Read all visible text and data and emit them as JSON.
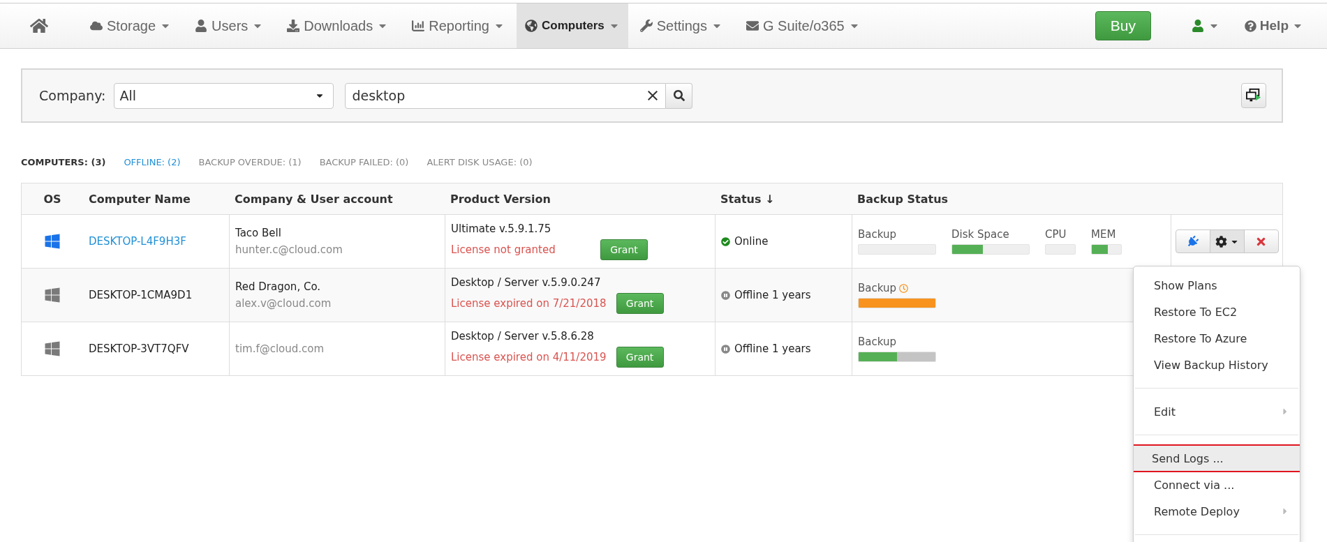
{
  "nav": {
    "items": [
      {
        "label": "Storage",
        "selected": false
      },
      {
        "label": "Users",
        "selected": false
      },
      {
        "label": "Downloads",
        "selected": false
      },
      {
        "label": "Reporting",
        "selected": false
      },
      {
        "label": "Computers",
        "selected": true
      },
      {
        "label": "Settings",
        "selected": false
      },
      {
        "label": "G Suite/o365",
        "selected": false
      }
    ],
    "buy": "Buy",
    "help": "Help"
  },
  "filter": {
    "company_label": "Company:",
    "company_value": "All",
    "search_value": "desktop"
  },
  "tabs": [
    {
      "label": "COMPUTERS: (3)",
      "selected": true,
      "kind": "normal"
    },
    {
      "label": "OFFLINE: (2)",
      "selected": false,
      "kind": "alert"
    },
    {
      "label": "BACKUP OVERDUE: (1)",
      "selected": false,
      "kind": "normal"
    },
    {
      "label": "BACKUP FAILED: (0)",
      "selected": false,
      "kind": "normal"
    },
    {
      "label": "ALERT DISK USAGE: (0)",
      "selected": false,
      "kind": "normal"
    }
  ],
  "table": {
    "columns": [
      "OS",
      "Computer Name",
      "Company & User account",
      "Product Version",
      "Status ↓",
      "Backup Status"
    ],
    "rows": [
      {
        "online": true,
        "name": "DESKTOP-L4F9H3F",
        "company": "Taco Bell",
        "account": "hunter.c@cloud.com",
        "version": "Ultimate v.5.9.1.75",
        "license": "License not granted",
        "grant": "Grant",
        "status": "Online",
        "meters": [
          {
            "label": "Backup",
            "level": 0,
            "kind": "normal"
          },
          {
            "label": "Disk Space",
            "level": 0.4,
            "kind": "normal"
          },
          {
            "label": "CPU",
            "level": 0,
            "kind": "normal"
          },
          {
            "label": "MEM",
            "level": 0.55,
            "kind": "normal"
          }
        ]
      },
      {
        "online": false,
        "name": "DESKTOP-1CMA9D1",
        "company": "Red Dragon, Co.",
        "account": "alex.v@cloud.com",
        "version": "Desktop / Server v.5.9.0.247",
        "license": "License expired on 7/21/2018",
        "grant": "Grant",
        "status": "Offline 1 years",
        "meters": [
          {
            "label": "Backup",
            "level": 1,
            "kind": "overdue"
          }
        ]
      },
      {
        "online": false,
        "name": "DESKTOP-3VT7QFV",
        "account": "tim.f@cloud.com",
        "version": "Desktop / Server v.5.8.6.28",
        "license": "License expired on 4/11/2019",
        "grant": "Grant",
        "status": "Offline 1 years",
        "meters": [
          {
            "label": "Backup",
            "level": 0.5,
            "kind": "partial"
          }
        ]
      }
    ]
  },
  "menu": {
    "groups": [
      [
        {
          "label": "Show Plans",
          "submenu": false,
          "highlighted": false
        },
        {
          "label": "Restore To EC2",
          "submenu": false,
          "highlighted": false
        },
        {
          "label": "Restore To Azure",
          "submenu": false,
          "highlighted": false
        },
        {
          "label": "View Backup History",
          "submenu": false,
          "highlighted": false
        }
      ],
      [
        {
          "label": "Edit",
          "submenu": true,
          "highlighted": false
        }
      ],
      [
        {
          "label": "Send Logs ...",
          "submenu": false,
          "highlighted": true
        },
        {
          "label": "Connect via ...",
          "submenu": false,
          "highlighted": false
        },
        {
          "label": "Remote Deploy",
          "submenu": true,
          "highlighted": false
        }
      ]
    ]
  }
}
